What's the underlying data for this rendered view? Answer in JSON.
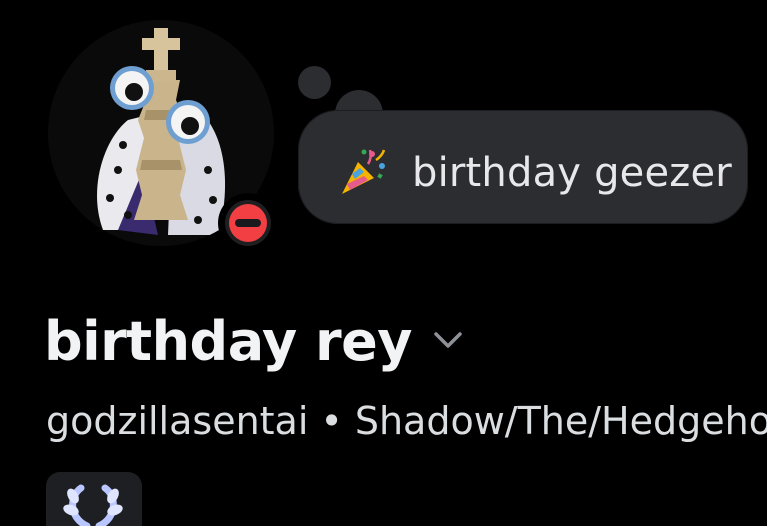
{
  "profile": {
    "avatar_icon": "chess-king-with-googly-eyes-avatar",
    "status": "do-not-disturb",
    "status_color": "#f23f43",
    "custom_status": {
      "emoji": "party-popper-icon",
      "text": "birthday geezer"
    },
    "display_name": "birthday rey",
    "username": "godzillasentai",
    "separator": "•",
    "pronouns": "Shadow/The/Hedgehog",
    "badge_icon": "laurel-wreath-badge-icon"
  },
  "colors": {
    "background": "#000000",
    "bubble": "#2b2d31",
    "name": "#f2f3f5",
    "secondary_text": "#dbdee1",
    "badge_bg": "#1e1f22",
    "badge_accent": "#b9c6ff"
  }
}
